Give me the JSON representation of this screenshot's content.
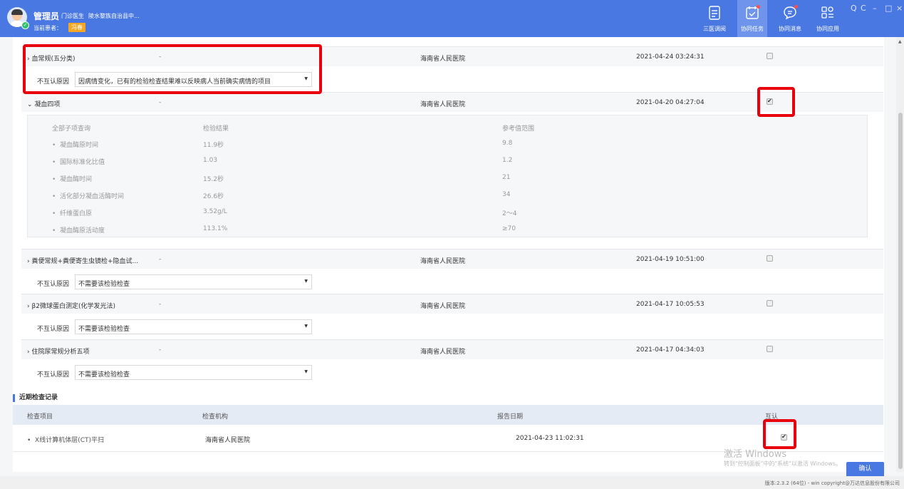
{
  "header": {
    "user_name": "管理员",
    "user_role": "门诊医生",
    "user_org": "陵水黎族自治县中...",
    "patient_label": "当前患者：",
    "patient_name": "冯春",
    "nav": [
      {
        "label": "三医调阅",
        "icon": "document-list-icon"
      },
      {
        "label": "协同任务",
        "icon": "calendar-check-icon"
      },
      {
        "label": "协同消息",
        "icon": "chat-bubble-icon"
      },
      {
        "label": "协同应用",
        "icon": "apps-grid-icon"
      }
    ],
    "window_controls": [
      "Q",
      "C",
      "–",
      "□",
      "×"
    ]
  },
  "tests": [
    {
      "name": "血常规(五分类)",
      "dash": "-",
      "org": "海南省人民医院",
      "date": "2021-04-24 03:24:31",
      "checked": false,
      "reason_label": "不互认原因",
      "reason": "因病情变化，已有的检验检查结果难以反映病人当前确实病情的项目"
    },
    {
      "name": "凝血四项",
      "dash": "-",
      "org": "海南省人民医院",
      "date": "2021-04-20 04:27:04",
      "checked": true,
      "expanded": true
    },
    {
      "name": "粪便常规+粪便寄生虫镜检+隐血试...",
      "dash": "-",
      "org": "海南省人民医院",
      "date": "2021-04-19 10:51:00",
      "checked": false,
      "reason_label": "不互认原因",
      "reason": "不需要该检验检查"
    },
    {
      "name": "β2微球蛋白测定(化学发光法)",
      "dash": "-",
      "org": "海南省人民医院",
      "date": "2021-04-17 10:05:53",
      "checked": false,
      "reason_label": "不互认原因",
      "reason": "不需要该检验检查"
    },
    {
      "name": "住院尿常规分析五项",
      "dash": "-",
      "org": "海南省人民医院",
      "date": "2021-04-17 04:34:03",
      "checked": false,
      "reason_label": "不互认原因",
      "reason": "不需要该检验检查"
    }
  ],
  "detail": {
    "headers": [
      "全部子项查询",
      "检验结果",
      "参考值范围"
    ],
    "items": [
      {
        "name": "凝血酶原时间",
        "result": "11.9秒",
        "range": "9.8"
      },
      {
        "name": "国际标准化比值",
        "result": "1.03",
        "range": "1.2"
      },
      {
        "name": "凝血酶时间",
        "result": "15.2秒",
        "range": "21"
      },
      {
        "name": "活化部分凝血活酶时间",
        "result": "26.6秒",
        "range": "34"
      },
      {
        "name": "纤维蛋白原",
        "result": "3.52g/L",
        "range": "2～4"
      },
      {
        "name": "凝血酶原活动度",
        "result": "113.1%",
        "range": "≥70"
      }
    ]
  },
  "recent": {
    "title": "近期检查记录",
    "headers": [
      "检查项目",
      "检查机构",
      "报告日期",
      "互认"
    ],
    "row": {
      "name": "X线计算机体层(CT)平扫",
      "org": "海南省人民医院",
      "date": "2021-04-23 11:02:31",
      "checked": true
    }
  },
  "confirm_label": "确认",
  "watermark": {
    "line1": "激活 Windows",
    "line2": "转到\"控制面板\"中的\"系统\"以激活 Windows。"
  },
  "footer": "版本:2.3.2 (64位) - win  copyright@万达信息股份有限公司",
  "colors": {
    "primary": "#4a78e2",
    "highlight": "#e8000d",
    "patient_badge": "#f5a623"
  }
}
